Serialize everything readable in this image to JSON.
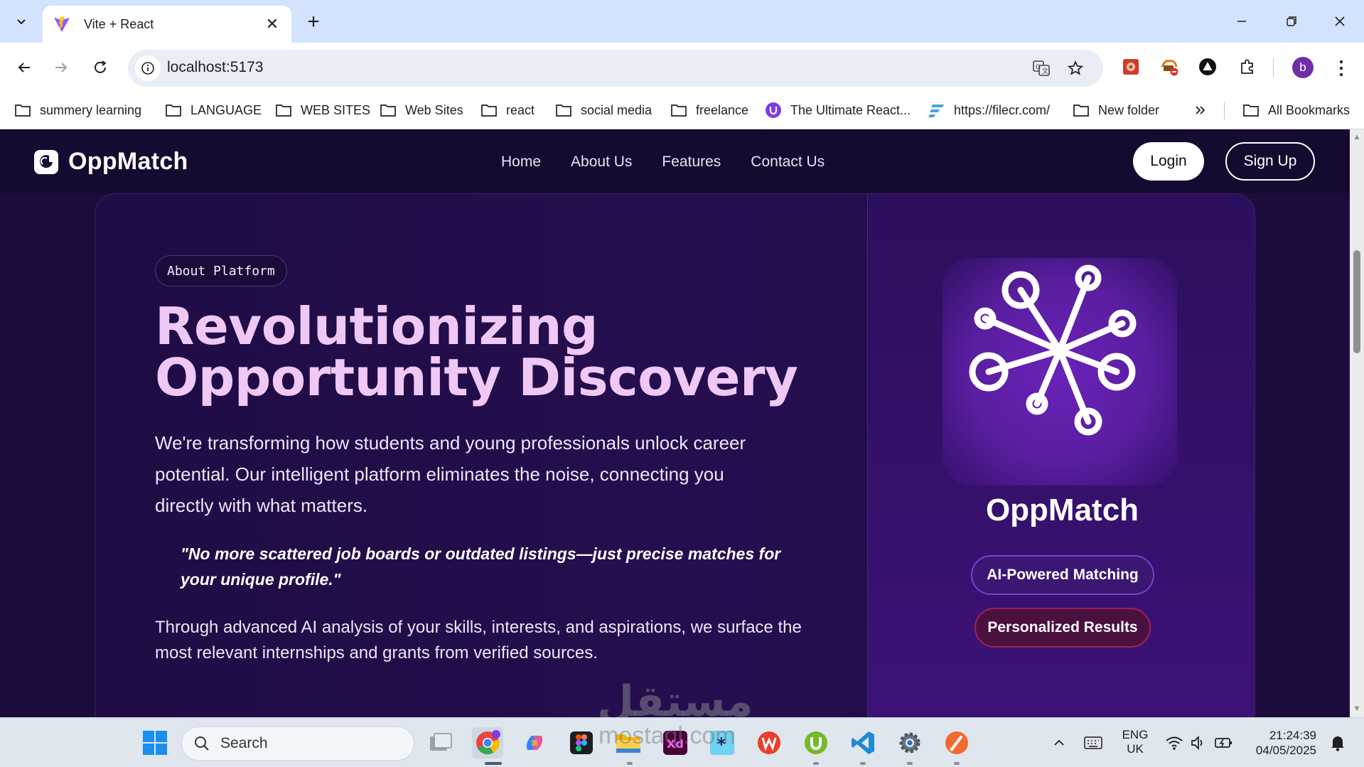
{
  "browser": {
    "tab_title": "Vite + React",
    "url": "localhost:5173",
    "profile_initial": "b",
    "bookmarks": [
      "summery learning",
      "LANGUAGE",
      "WEB SITES",
      "Web Sites",
      "react",
      "social media",
      "freelance",
      "The Ultimate React...",
      "https://filecr.com/",
      "New folder"
    ],
    "all_bookmarks": "All Bookmarks"
  },
  "site": {
    "brand": "OppMatch",
    "nav": [
      "Home",
      "About Us",
      "Features",
      "Contact Us"
    ],
    "login": "Login",
    "signup": "Sign Up"
  },
  "hero": {
    "badge": "About Platform",
    "headline_line1": "Revolutionizing",
    "headline_line2": "Opportunity Discovery",
    "paragraph": "We're transforming how students and young professionals unlock career potential. Our intelligent platform eliminates the noise, connecting you directly with what matters.",
    "quote": "\"No more scattered job boards or outdated listings—just precise matches for your unique profile.\"",
    "paragraph2": "Through advanced AI analysis of your skills, interests, and aspirations, we surface the most relevant internships and grants from verified sources."
  },
  "showcase": {
    "logo_text": "OppMatch",
    "pill_ai": "AI-Powered Matching",
    "pill_personal": "Personalized Results"
  },
  "watermark": {
    "arabic": "مستقل",
    "latin": "mostaql.com"
  },
  "taskbar": {
    "search_placeholder": "Search",
    "lang_line1": "ENG",
    "lang_line2": "UK",
    "time": "21:24:39",
    "date": "04/05/2025"
  },
  "colors": {
    "page_bg": "#1c0c3b",
    "headline": "#f0c8f5",
    "accent_purple": "#3c1673",
    "accent_magenta": "#4a1040",
    "tabstrip": "#d3e3fd"
  }
}
